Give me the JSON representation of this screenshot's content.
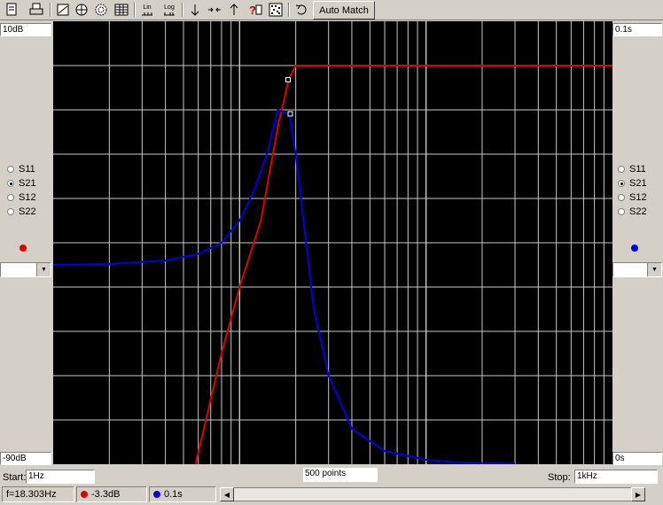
{
  "toolbar": {
    "icons": [
      "print-preview-icon",
      "print-icon",
      "smith-chart-icon",
      "polar-chart-icon",
      "polar-grid-icon",
      "table-icon",
      "linear-scale-icon",
      "log-scale-icon",
      "arrow-down-icon",
      "compress-icon",
      "arrow-up-icon",
      "help-icon",
      "noise-icon",
      "undo-icon"
    ],
    "lin_label": "Lin",
    "log_label": "Log",
    "automatch_label": "Auto Match"
  },
  "left_panel": {
    "top_value": "10dB",
    "bottom_value": "-90dB",
    "radios": [
      "S11",
      "S21",
      "S12",
      "S22"
    ],
    "selected": "S21",
    "dot_color": "#e00000",
    "combo_value": ""
  },
  "right_panel": {
    "top_value": "0.1s",
    "bottom_value": "0s",
    "radios": [
      "S11",
      "S21",
      "S12",
      "S22"
    ],
    "selected": "S21",
    "dot_color": "#0000e0",
    "combo_value": ""
  },
  "plot": {
    "points_label": "500 points"
  },
  "frequency": {
    "start_label": "Start:",
    "start_value": "1Hz",
    "stop_label": "Stop:",
    "stop_value": "1kHz"
  },
  "status": {
    "freq": "f=18.303Hz",
    "mag": "-3.3dB",
    "delay": "0.1s",
    "mag_color": "#e00000",
    "delay_color": "#0000e0"
  },
  "chart_data": {
    "type": "line",
    "xscale": "log",
    "xlim": [
      1,
      1000
    ],
    "grid": true,
    "left_axis": {
      "ylim": [
        -90,
        10
      ],
      "unit": "dB"
    },
    "right_axis": {
      "ylim": [
        0,
        0.1
      ],
      "unit": "s"
    },
    "series": [
      {
        "color": "#e00000",
        "axis": "left",
        "x": [
          5.8,
          8,
          10,
          13,
          16,
          18.3,
          20,
          22,
          25,
          30,
          50,
          100,
          1000
        ],
        "y": [
          -90,
          -65,
          -50,
          -35,
          -14,
          -3.3,
          0,
          0,
          0,
          0,
          0,
          0,
          0
        ]
      },
      {
        "color": "#0000e0",
        "axis": "right",
        "x": [
          1,
          2,
          4,
          6,
          8,
          10,
          12,
          14,
          16,
          18.5,
          20,
          22,
          25,
          30,
          40,
          60,
          100,
          150,
          300
        ],
        "y": [
          0.045,
          0.0452,
          0.046,
          0.0475,
          0.05,
          0.055,
          0.062,
          0.07,
          0.08,
          0.079,
          0.07,
          0.055,
          0.035,
          0.02,
          0.008,
          0.003,
          0.001,
          0.0004,
          0.0001
        ]
      }
    ],
    "markers": [
      {
        "series": 0,
        "x": 18.3,
        "y": -3.3
      },
      {
        "series": 1,
        "x": 18.8,
        "y": 0.079
      }
    ]
  }
}
